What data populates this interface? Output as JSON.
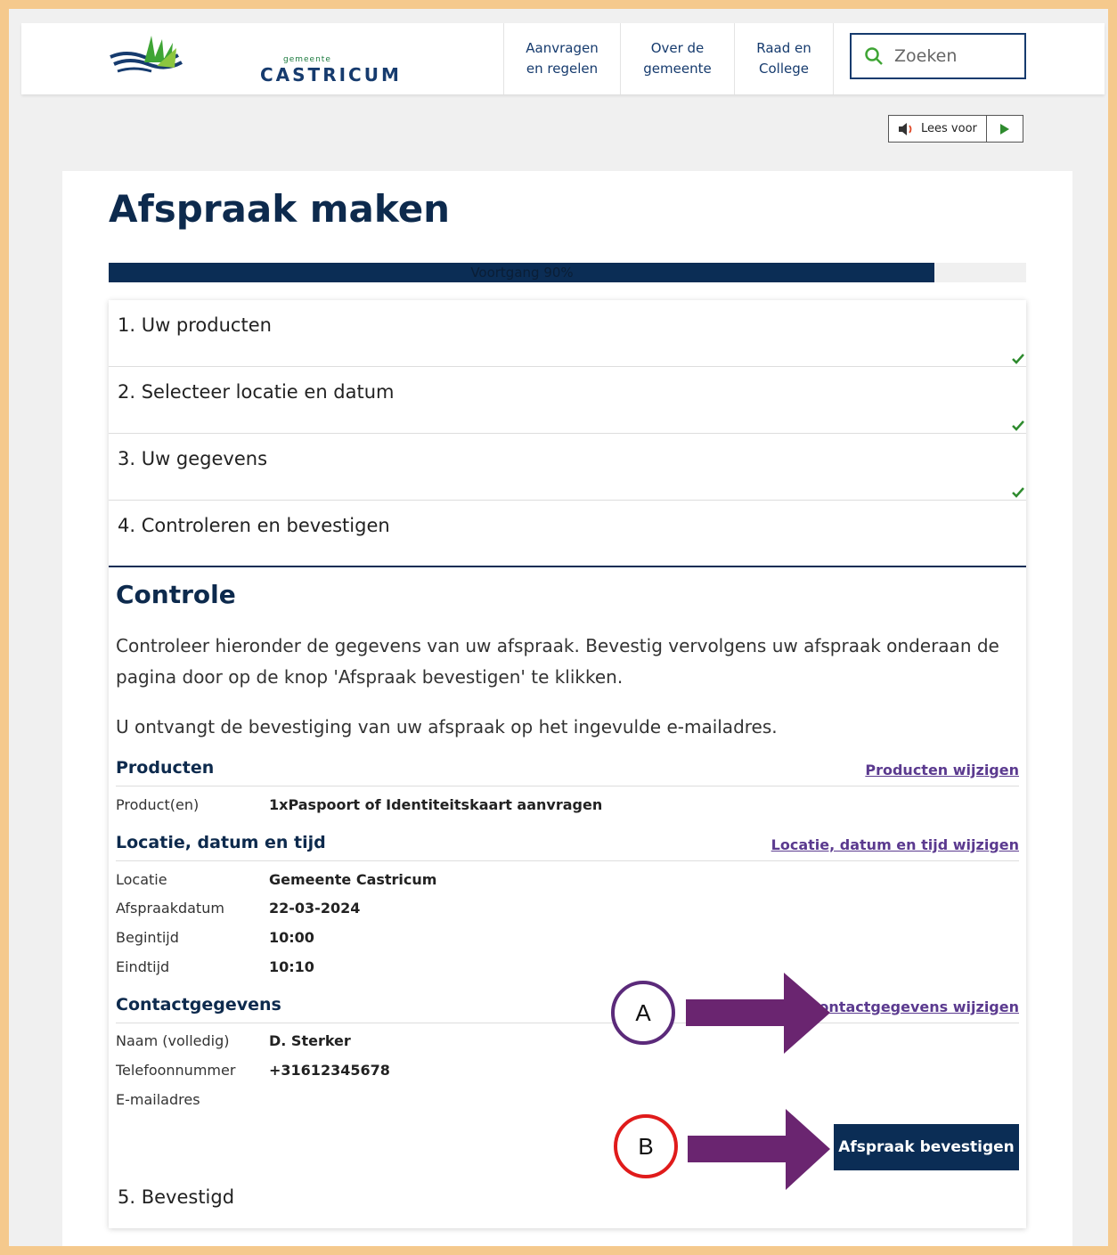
{
  "header": {
    "logo_small": "gemeente",
    "logo_text": "CASTRICUM",
    "nav": [
      {
        "label": "Aanvragen\nen regelen"
      },
      {
        "label": "Over de\ngemeente"
      },
      {
        "label": "Raad en\nCollege"
      }
    ],
    "search": {
      "placeholder": "Zoeken",
      "icon": "search-icon"
    }
  },
  "readaloud": {
    "label": "Lees voor",
    "icon": "speaker-icon",
    "play_icon": "play-icon"
  },
  "page": {
    "title": "Afspraak maken"
  },
  "progress": {
    "label": "Voortgang 90%",
    "percent": 90
  },
  "steps": [
    {
      "label": "1. Uw producten",
      "done": true
    },
    {
      "label": "2. Selecteer locatie en datum",
      "done": true
    },
    {
      "label": "3. Uw gegevens",
      "done": true
    },
    {
      "label": "4. Controleren en bevestigen",
      "done": false
    }
  ],
  "controle": {
    "heading": "Controle",
    "intro": "Controleer hieronder de gegevens van uw afspraak. Bevestig vervolgens uw afspraak onderaan de pagina door op de knop 'Afspraak bevestigen' te klikken.",
    "note": "U ontvangt de bevestiging van uw afspraak op het ingevulde e-mailadres."
  },
  "producten": {
    "heading": "Producten",
    "edit": "Producten wijzigen",
    "rows": [
      {
        "key": "Product(en)",
        "value": "1xPaspoort of Identiteitskaart aanvragen"
      }
    ]
  },
  "locatie": {
    "heading": "Locatie, datum en tijd",
    "edit": "Locatie, datum en tijd wijzigen",
    "rows": [
      {
        "key": "Locatie",
        "value": "Gemeente Castricum"
      },
      {
        "key": "Afspraakdatum",
        "value": "22-03-2024"
      },
      {
        "key": "Begintijd",
        "value": "10:00"
      },
      {
        "key": "Eindtijd",
        "value": "10:10"
      }
    ]
  },
  "contact": {
    "heading": "Contactgegevens",
    "edit": "Contactgegevens wijzigen",
    "rows": [
      {
        "key": "Naam (volledig)",
        "value": "D. Sterker"
      },
      {
        "key": "Telefoonnummer",
        "value": "+31612345678"
      },
      {
        "key": "E-mailadres",
        "value": ""
      }
    ]
  },
  "confirm_button": "Afspraak bevestigen",
  "step5": "5. Bevestigd",
  "annotations": [
    {
      "label": "A",
      "ring_color": "#5b2a7a",
      "arrow_color": "#6a2570"
    },
    {
      "label": "B",
      "ring_color": "#e01b1b",
      "arrow_color": "#6a2570"
    }
  ],
  "colors": {
    "primary": "#0b2d55",
    "link": "#5b3a8f",
    "frame": "#f5c98d",
    "check": "#2e8b2e"
  }
}
